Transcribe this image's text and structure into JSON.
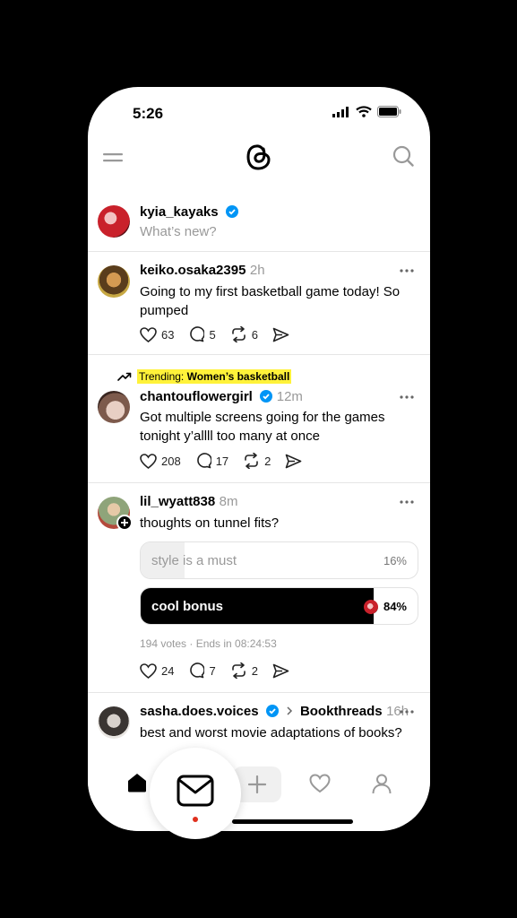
{
  "status": {
    "time": "5:26"
  },
  "composer": {
    "username": "kyia_kayaks",
    "placeholder": "What’s new?"
  },
  "posts": [
    {
      "username": "keiko.osaka2395",
      "age": "2h",
      "text": "Going to my first basketball game today! So pumped",
      "likes": "63",
      "replies": "5",
      "reposts": "6"
    },
    {
      "trending_prefix": "Trending: ",
      "trending_topic": "Women’s basketball",
      "username": "chantouflowergirl",
      "age": "12m",
      "text": "Got multiple screens going for the games tonight y’allll too many at once",
      "likes": "208",
      "replies": "17",
      "reposts": "2"
    },
    {
      "username": "lil_wyatt838",
      "age": "8m",
      "text": "thoughts on tunnel fits?",
      "poll": {
        "options": [
          {
            "label": "style is a must",
            "pct": "16%",
            "fraction": 0.16
          },
          {
            "label": "cool bonus",
            "pct": "84%",
            "fraction": 0.84,
            "selected": true
          }
        ],
        "info": "194 votes · Ends in 08:24:53"
      },
      "likes": "24",
      "replies": "7",
      "reposts": "2"
    },
    {
      "username": "sasha.does.voices",
      "community": "Bookthreads",
      "age": "16h",
      "text": "best and worst movie adaptations of books?"
    }
  ],
  "colors": {
    "verified": "#0095f6",
    "trend_highlight": "#fff23a",
    "notification_dot": "#e0301e"
  }
}
